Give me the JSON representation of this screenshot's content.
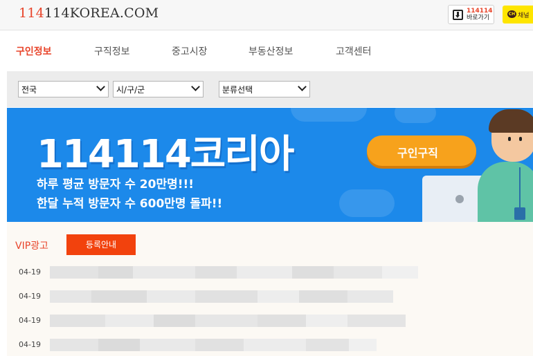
{
  "site": {
    "logo_accent": "114",
    "logo_rest": "114KOREA.COM",
    "app_button_line1": "114114",
    "app_button_line2": "바로가기",
    "kakao_label": "채널",
    "kakao_bubble": "CH"
  },
  "nav": {
    "items": [
      {
        "label": "구인정보",
        "active": true
      },
      {
        "label": "구직정보",
        "active": false
      },
      {
        "label": "중고시장",
        "active": false
      },
      {
        "label": "부동산정보",
        "active": false
      },
      {
        "label": "고객센터",
        "active": false
      }
    ]
  },
  "filters": {
    "region": "전국",
    "district": "시/구/군",
    "category": "분류선택"
  },
  "banner": {
    "title": "114114코리아",
    "line1": "하루 평균 방문자 수 20만명!!!",
    "line2": "한달 누적 방문자 수 600만명 돌파!!",
    "pill": "구인구직"
  },
  "vip": {
    "title": "VIP광고",
    "register_label": "등록안내",
    "rows": [
      {
        "date": "04-19"
      },
      {
        "date": "04-19"
      },
      {
        "date": "04-19"
      },
      {
        "date": "04-19"
      }
    ]
  },
  "colors": {
    "accent": "#e8442a",
    "banner_blue": "#1c89ea",
    "register_button": "#f2420d",
    "kakao_yellow": "#fee500"
  }
}
